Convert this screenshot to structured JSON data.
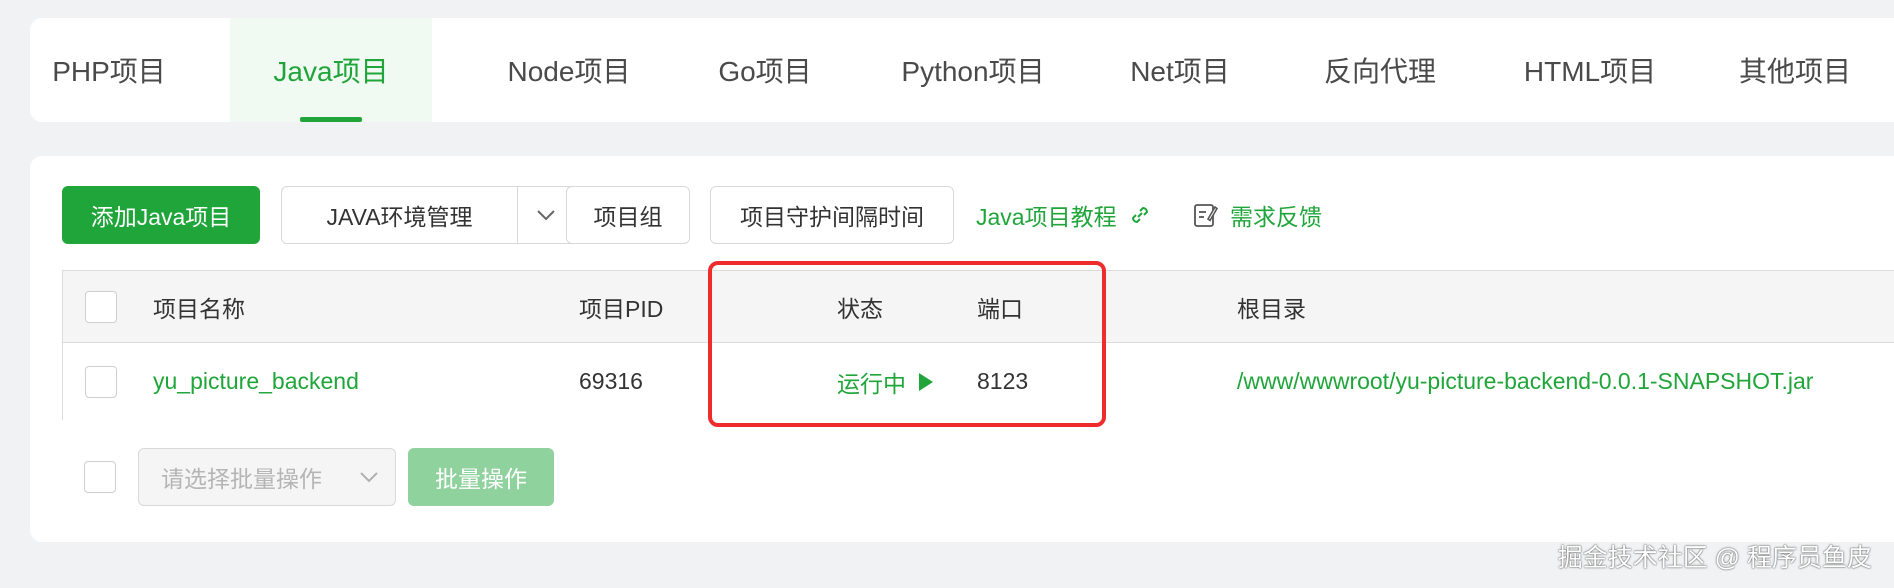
{
  "tabs": [
    {
      "label": "PHP项目"
    },
    {
      "label": "Java项目",
      "active": true
    },
    {
      "label": "Node项目"
    },
    {
      "label": "Go项目"
    },
    {
      "label": "Python项目"
    },
    {
      "label": "Net项目"
    },
    {
      "label": "反向代理"
    },
    {
      "label": "HTML项目"
    },
    {
      "label": "其他项目"
    }
  ],
  "toolbar": {
    "add_label": "添加Java项目",
    "java_env_label": "JAVA环境管理",
    "project_group_label": "项目组",
    "guard_interval_label": "项目守护间隔时间",
    "tutorial_label": "Java项目教程",
    "feedback_label": "需求反馈"
  },
  "table": {
    "headers": {
      "name": "项目名称",
      "pid": "项目PID",
      "status": "状态",
      "port": "端口",
      "root": "根目录"
    },
    "rows": [
      {
        "name": "yu_picture_backend",
        "pid": "69316",
        "status": "运行中",
        "port": "8123",
        "root": "/www/wwwroot/yu-picture-backend-0.0.1-SNAPSHOT.jar"
      }
    ]
  },
  "batch": {
    "placeholder": "请选择批量操作",
    "button_label": "批量操作"
  },
  "watermark": "掘金技术社区 @ 程序员鱼皮",
  "colors": {
    "brand_green": "#20a53a",
    "highlight_red": "#ef2c2c",
    "page_bg": "#f1f2f3"
  }
}
